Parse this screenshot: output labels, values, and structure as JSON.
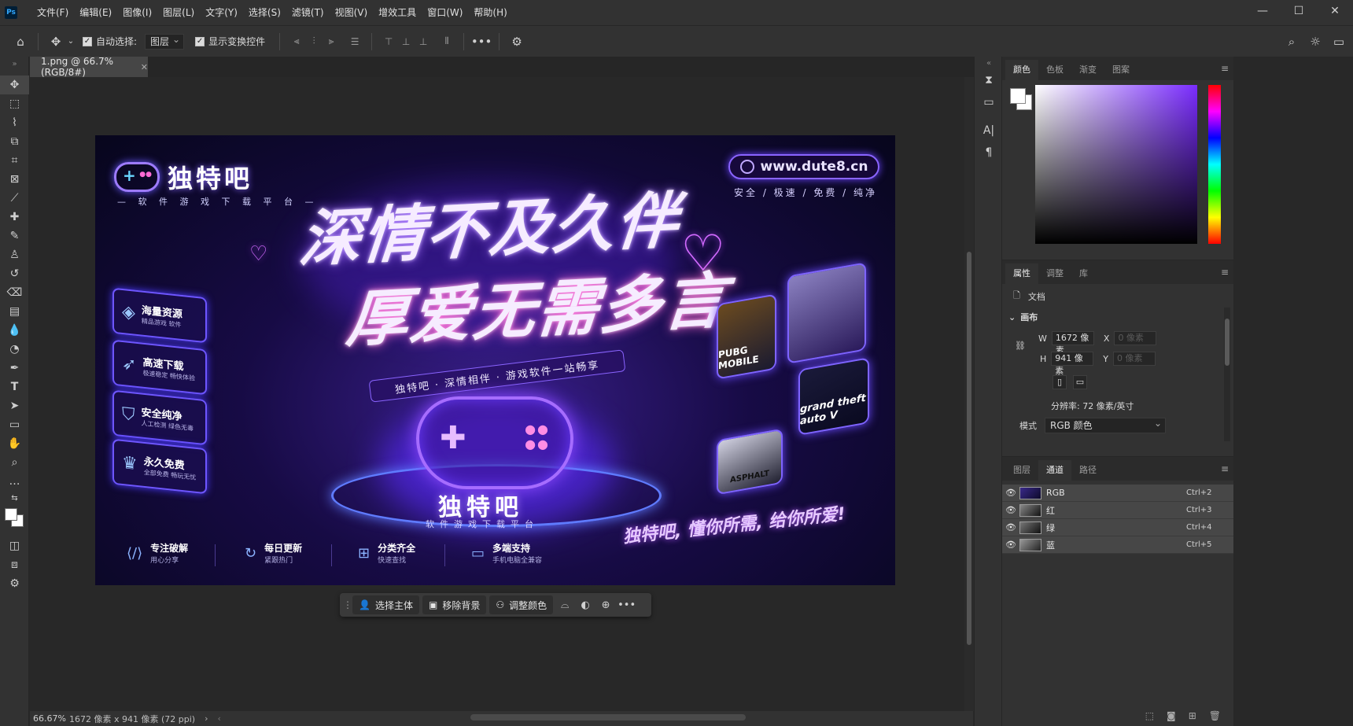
{
  "app": {
    "logo": "Ps"
  },
  "menu": [
    "文件(F)",
    "编辑(E)",
    "图像(I)",
    "图层(L)",
    "文字(Y)",
    "选择(S)",
    "滤镜(T)",
    "视图(V)",
    "增效工具",
    "窗口(W)",
    "帮助(H)"
  ],
  "window_controls": {
    "minimize": "—",
    "maximize": "☐",
    "close": "✕"
  },
  "options": {
    "auto_select_label": "自动选择:",
    "auto_select_target": "图层",
    "show_transform_label": "显示变换控件",
    "auto_select_checked": true,
    "show_transform_checked": true
  },
  "document": {
    "tab_title": "1.png @ 66.7%(RGB/8#)",
    "zoom": "66.67%",
    "info": "1672 像素 x 941 像素 (72 ppi)"
  },
  "poster": {
    "brand": "独特吧",
    "brand_sub": "— 软 件 游 戏 下 载 平 台 —",
    "url": "www.dute8.cn",
    "tagline": "安全 / 极速 / 免费 / 纯净",
    "headline1": "深情不及久伴",
    "headline2": "厚爱无需多言",
    "ribbon": "独特吧 · 深情相伴 · 游戏软件一站畅享",
    "features": [
      {
        "title": "海量资源",
        "sub": "精品游戏 软件"
      },
      {
        "title": "高速下载",
        "sub": "极速稳定 畅快体验"
      },
      {
        "title": "安全纯净",
        "sub": "人工检测 绿色无毒"
      },
      {
        "title": "永久免费",
        "sub": "全部免费 畅玩无忧"
      }
    ],
    "bottom_brand": "独特吧",
    "bottom_sub": "软件游戏下载平台",
    "slogan": "独特吧, 懂你所需, 给你所爱!",
    "footer": [
      {
        "title": "专注破解",
        "sub": "用心分享"
      },
      {
        "title": "每日更新",
        "sub": "紧跟热门"
      },
      {
        "title": "分类齐全",
        "sub": "快速查找"
      },
      {
        "title": "多端支持",
        "sub": "手机电脑全兼容"
      }
    ],
    "game_cards": [
      "PUBG MOBILE",
      "ASPHALT",
      "grand theft auto V"
    ]
  },
  "context_bar": {
    "select_subject": "选择主体",
    "remove_bg": "移除背景",
    "adjust_color": "调整颜色"
  },
  "color_panel": {
    "tabs": [
      "颜色",
      "色板",
      "渐变",
      "图案"
    ],
    "active": "颜色"
  },
  "properties_panel": {
    "tabs": [
      "属性",
      "调整",
      "库"
    ],
    "doc_label": "文档",
    "section": "画布",
    "w_label": "W",
    "w_value": "1672 像素",
    "h_label": "H",
    "h_value": "941 像素",
    "x_label": "X",
    "x_placeholder": "0 像素",
    "y_label": "Y",
    "y_placeholder": "0 像素",
    "resolution": "分辨率: 72 像素/英寸",
    "mode_label": "模式",
    "mode_value": "RGB 颜色"
  },
  "channels_panel": {
    "tabs": [
      "图层",
      "通道",
      "路径"
    ],
    "active": "通道",
    "channels": [
      {
        "name": "RGB",
        "key": "Ctrl+2"
      },
      {
        "name": "红",
        "key": "Ctrl+3"
      },
      {
        "name": "绿",
        "key": "Ctrl+4"
      },
      {
        "name": "蓝",
        "key": "Ctrl+5"
      }
    ]
  }
}
